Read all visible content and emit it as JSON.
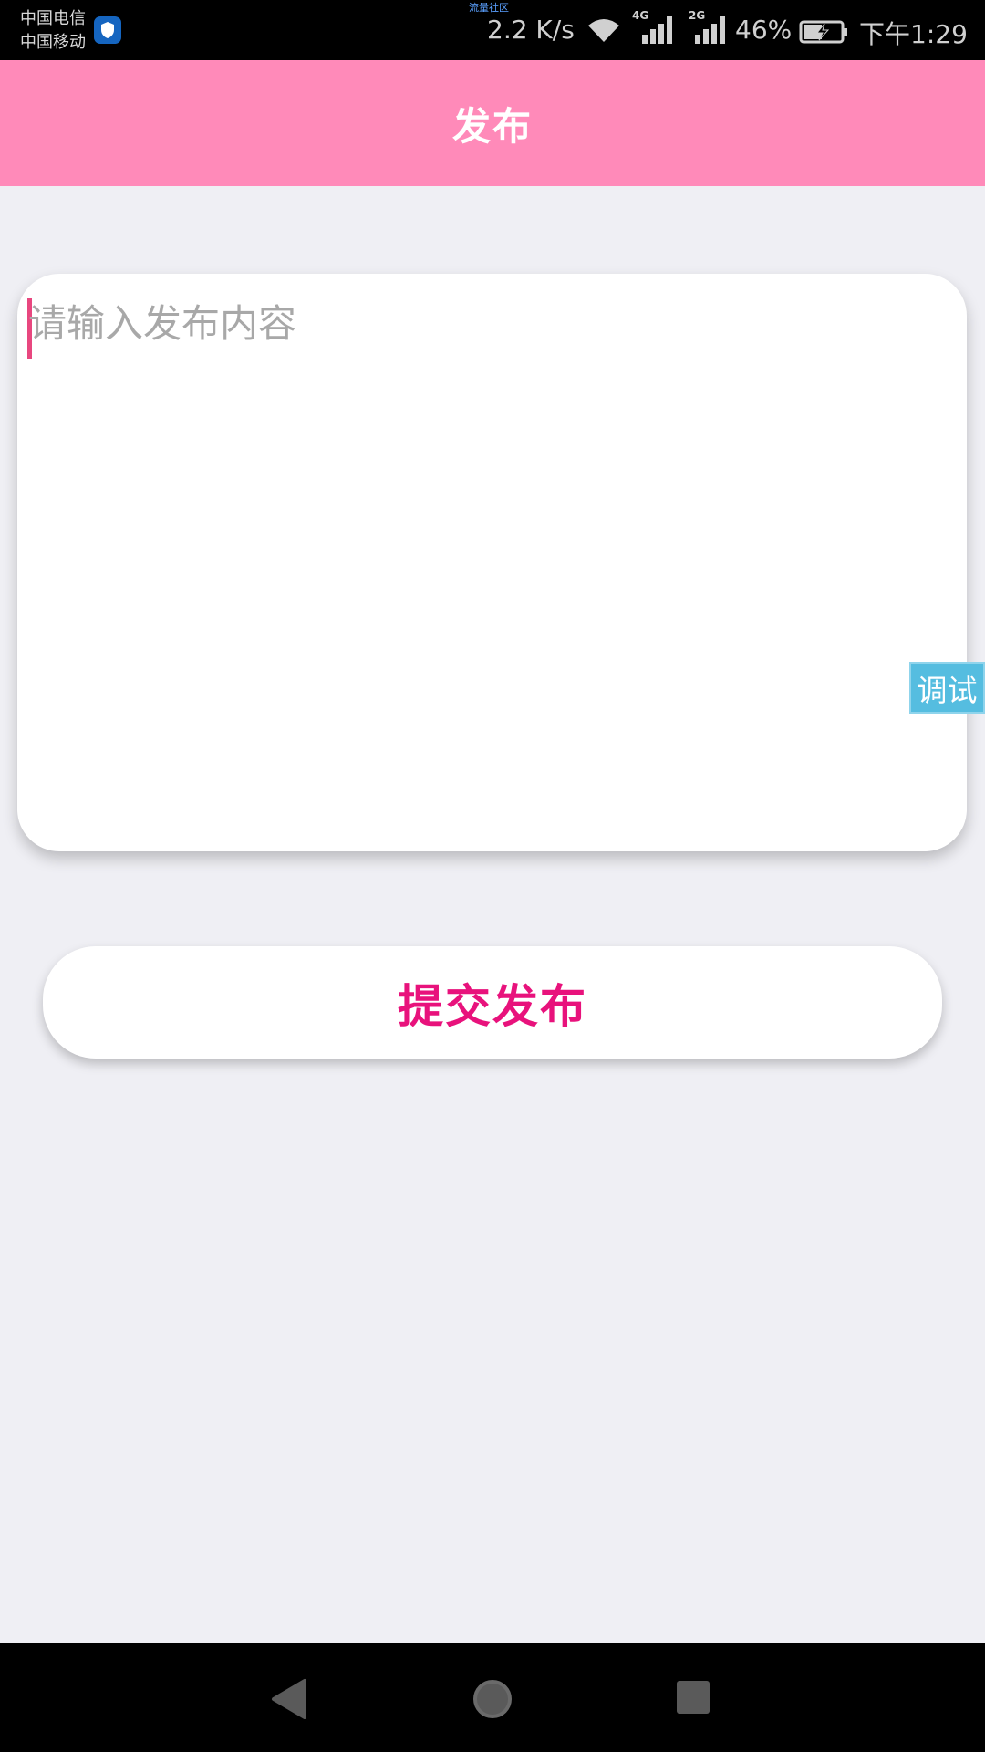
{
  "status_bar": {
    "carrier_1": "中国电信",
    "carrier_2": "中国移动",
    "shield_icon": "shield-icon",
    "traffic_label": "流量社区",
    "net_speed": "2.2 K/s",
    "signal_1_type": "4G",
    "signal_2_type": "2G",
    "battery_percent": "46%",
    "time": "下午1:29"
  },
  "header": {
    "title": "发布"
  },
  "editor": {
    "placeholder": "请输入发布内容",
    "value": ""
  },
  "debug": {
    "label": "调试"
  },
  "submit": {
    "label": "提交发布"
  },
  "colors": {
    "header_bg": "#ff8ab9",
    "accent": "#e8127c",
    "cursor": "#e8477f",
    "page_bg": "#efeff4",
    "debug_bg": "#55bde0"
  }
}
